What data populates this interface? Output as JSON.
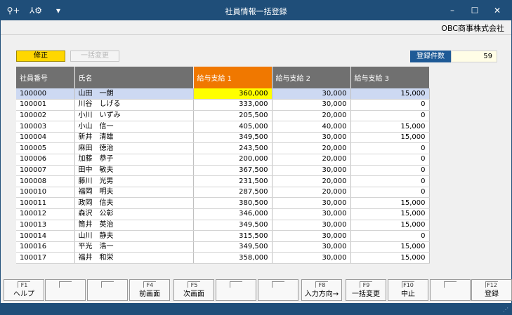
{
  "window": {
    "title": "社員情報一括登録",
    "company": "OBC商事株式会社"
  },
  "toolbar": {
    "shusei": "修正",
    "ikkatsu_henko": "一括変更"
  },
  "count": {
    "label": "登録件数",
    "value": "59"
  },
  "columns": [
    "社員番号",
    "氏名",
    "給与支給 1",
    "給与支給 2",
    "給与支給 3"
  ],
  "rows": [
    [
      "100000",
      "山田　一朗",
      "360,000",
      "30,000",
      "15,000"
    ],
    [
      "100001",
      "川谷　しげる",
      "333,000",
      "30,000",
      "0"
    ],
    [
      "100002",
      "小川　いずみ",
      "205,500",
      "20,000",
      "0"
    ],
    [
      "100003",
      "小山　信一",
      "405,000",
      "40,000",
      "15,000"
    ],
    [
      "100004",
      "新井　清雄",
      "349,500",
      "30,000",
      "15,000"
    ],
    [
      "100005",
      "麻田　徳治",
      "243,500",
      "20,000",
      "0"
    ],
    [
      "100006",
      "加藤　恭子",
      "200,000",
      "20,000",
      "0"
    ],
    [
      "100007",
      "田中　敏夫",
      "367,500",
      "30,000",
      "0"
    ],
    [
      "100008",
      "藤川　光男",
      "231,500",
      "20,000",
      "0"
    ],
    [
      "100010",
      "福岡　明夫",
      "287,500",
      "20,000",
      "0"
    ],
    [
      "100011",
      "政岡　信夫",
      "380,500",
      "30,000",
      "15,000"
    ],
    [
      "100012",
      "森沢　公彰",
      "346,000",
      "30,000",
      "15,000"
    ],
    [
      "100013",
      "筒井　英治",
      "349,500",
      "30,000",
      "15,000"
    ],
    [
      "100014",
      "山川　静夫",
      "315,500",
      "30,000",
      "0"
    ],
    [
      "100016",
      "平光　浩一",
      "349,500",
      "30,000",
      "15,000"
    ],
    [
      "100017",
      "福井　和栄",
      "358,000",
      "30,000",
      "15,000"
    ]
  ],
  "fkeys": [
    {
      "key": "F1",
      "label": "ヘルプ"
    },
    {
      "key": "",
      "label": ""
    },
    {
      "key": "",
      "label": ""
    },
    {
      "key": "F4",
      "label": "前画面"
    },
    {
      "key": "F5",
      "label": "次画面"
    },
    {
      "key": "",
      "label": ""
    },
    {
      "key": "",
      "label": ""
    },
    {
      "key": "F8",
      "label": "入力方向→"
    },
    {
      "key": "F9",
      "label": "一括変更"
    },
    {
      "key": "F10",
      "label": "中止"
    },
    {
      "key": "",
      "label": ""
    },
    {
      "key": "F12",
      "label": "登録"
    }
  ]
}
